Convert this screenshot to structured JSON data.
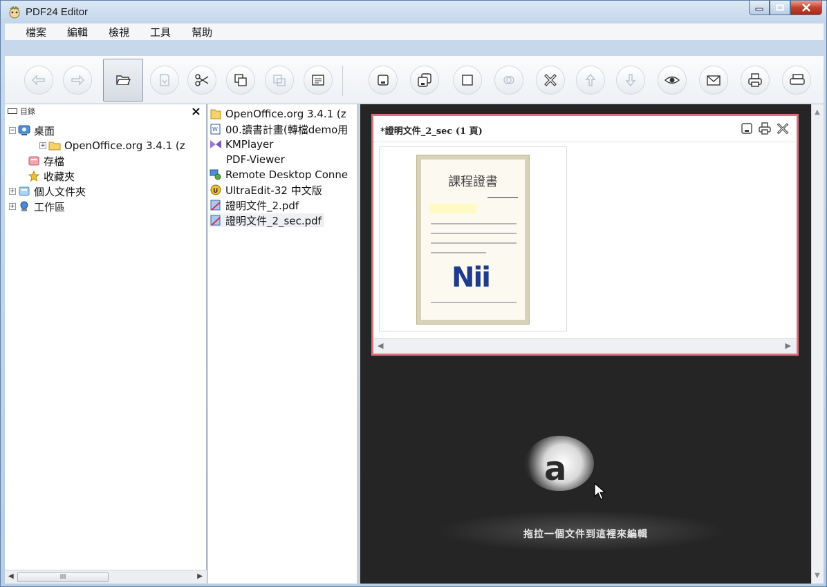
{
  "window": {
    "title": "PDF24 Editor"
  },
  "menu": [
    "檔案",
    "編輯",
    "檢視",
    "工具",
    "幫助"
  ],
  "toolbar": {
    "buttons": [
      {
        "name": "back-icon"
      },
      {
        "name": "forward-icon"
      },
      {
        "name": "open-folder-icon",
        "active": true
      },
      {
        "name": "import-icon"
      },
      {
        "name": "cut-icon"
      },
      {
        "name": "copy-icon"
      },
      {
        "name": "paste-icon"
      },
      {
        "name": "layout-icon"
      },
      {
        "name": "save-icon"
      },
      {
        "name": "save-as-icon"
      },
      {
        "name": "blank-page-icon"
      },
      {
        "name": "merge-icon"
      },
      {
        "name": "delete-icon"
      },
      {
        "name": "move-up-icon"
      },
      {
        "name": "move-down-icon"
      },
      {
        "name": "preview-icon"
      },
      {
        "name": "mail-icon"
      },
      {
        "name": "print-icon"
      },
      {
        "name": "print-more-icon"
      }
    ]
  },
  "left_panel": {
    "title": "目錄",
    "close": "×",
    "tree": [
      {
        "label": "桌面",
        "icon": "desktop-icon",
        "expand": "−"
      },
      {
        "label": "OpenOffice.org 3.4.1 (z",
        "icon": "folder-icon",
        "expand": "+"
      },
      {
        "label": "存檔",
        "icon": "archive-icon",
        "expand": ""
      },
      {
        "label": "收藏夾",
        "icon": "star-icon",
        "expand": ""
      },
      {
        "label": "個人文件夾",
        "icon": "user-folder-icon",
        "expand": "+"
      },
      {
        "label": "工作區",
        "icon": "workspace-icon",
        "expand": "+"
      }
    ],
    "scroll_grip": "III"
  },
  "file_list": [
    {
      "label": "OpenOffice.org 3.4.1 (z",
      "icon": "folder-icon"
    },
    {
      "label": "00.讀書計畫(轉檔demo用",
      "icon": "word-doc-icon"
    },
    {
      "label": "KMPlayer",
      "icon": "kmplayer-icon"
    },
    {
      "label": "PDF-Viewer",
      "icon": ""
    },
    {
      "label": "Remote Desktop Conne",
      "icon": "remote-desktop-icon"
    },
    {
      "label": "UltraEdit-32 中文版",
      "icon": "ultraedit-icon"
    },
    {
      "label": "證明文件_2.pdf",
      "icon": "pdf-icon"
    },
    {
      "label": "證明文件_2_sec.pdf",
      "icon": "pdf-icon",
      "selected": true
    }
  ],
  "document": {
    "title": "*證明文件_2_sec (1 頁)",
    "cert_title": "課程證書",
    "cert_logo": "Nii"
  },
  "dropzone": {
    "glyph": "a",
    "text": "拖拉一個文件到這裡來編輯"
  },
  "colors": {
    "accent_frame": "#d9707a",
    "workspace_bg": "#252525"
  }
}
